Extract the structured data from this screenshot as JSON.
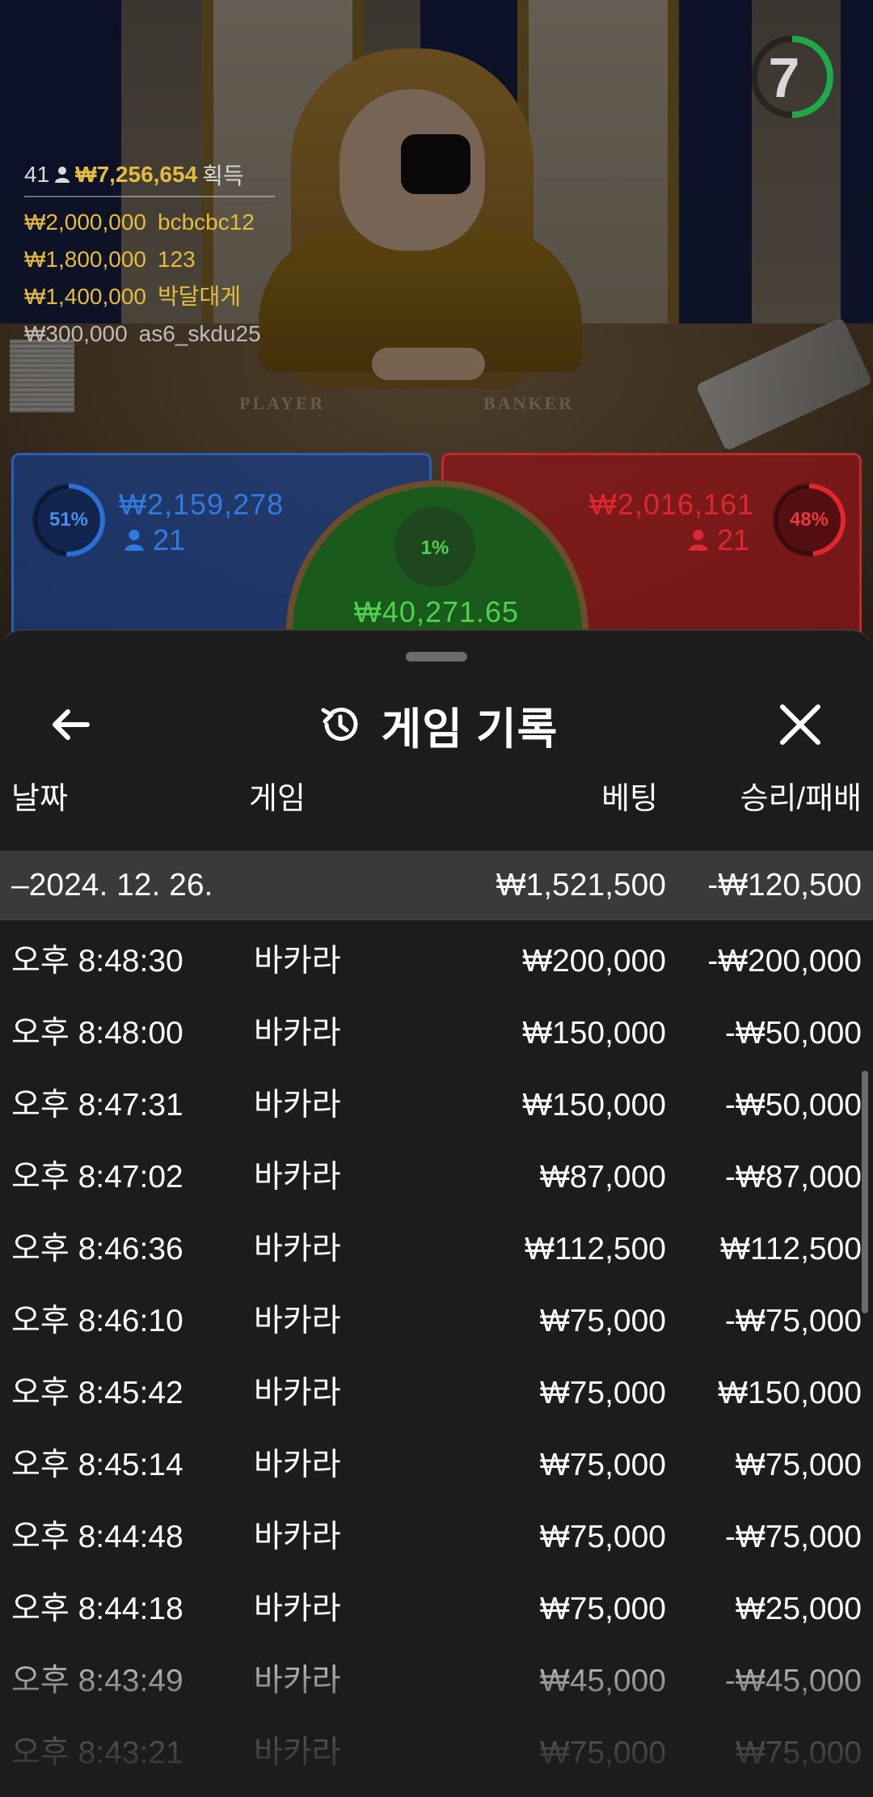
{
  "stream": {
    "timer": "7",
    "table_labels": {
      "player": "PLAYER",
      "banker": "BANKER"
    },
    "winners": {
      "count": "41",
      "total": "₩7,256,654",
      "total_label": "획득",
      "entries": [
        {
          "amount": "₩2,000,000",
          "name": "bcbcbc12"
        },
        {
          "amount": "₩1,800,000",
          "name": "123"
        },
        {
          "amount": "₩1,400,000",
          "name": "박달대게"
        },
        {
          "amount": "₩300,000",
          "name": "as6_skdu25"
        }
      ]
    },
    "player": {
      "percent_label": "51%",
      "percent": 51,
      "amount": "₩2,159,278",
      "count": "21"
    },
    "banker": {
      "percent_label": "48%",
      "percent": 48,
      "amount": "₩2,016,161",
      "count": "21"
    },
    "tie": {
      "percent_label": "1%",
      "amount": "₩40,271.65"
    },
    "colors": {
      "player": "#2a6fd6",
      "banker": "#d8262d",
      "tie": "#3fbf3f",
      "gold": "#e5bc3b"
    }
  },
  "sheet": {
    "title": "게임 기록",
    "icons": {
      "back": "arrow-left-icon",
      "history": "history-icon",
      "close": "close-icon"
    },
    "columns": {
      "date": "날짜",
      "game": "게임",
      "bet": "베팅",
      "result": "승리/패배"
    },
    "day_summary": {
      "date": "–2024. 12. 26.",
      "bet": "₩1,521,500",
      "result": "-₩120,500"
    },
    "rows": [
      {
        "time": "오후 8:48:30",
        "game": "바카라",
        "bet": "₩200,000",
        "result": "-₩200,000"
      },
      {
        "time": "오후 8:48:00",
        "game": "바카라",
        "bet": "₩150,000",
        "result": "-₩50,000"
      },
      {
        "time": "오후 8:47:31",
        "game": "바카라",
        "bet": "₩150,000",
        "result": "-₩50,000"
      },
      {
        "time": "오후 8:47:02",
        "game": "바카라",
        "bet": "₩87,000",
        "result": "-₩87,000"
      },
      {
        "time": "오후 8:46:36",
        "game": "바카라",
        "bet": "₩112,500",
        "result": "₩112,500"
      },
      {
        "time": "오후 8:46:10",
        "game": "바카라",
        "bet": "₩75,000",
        "result": "-₩75,000"
      },
      {
        "time": "오후 8:45:42",
        "game": "바카라",
        "bet": "₩75,000",
        "result": "₩150,000"
      },
      {
        "time": "오후 8:45:14",
        "game": "바카라",
        "bet": "₩75,000",
        "result": "₩75,000"
      },
      {
        "time": "오후 8:44:48",
        "game": "바카라",
        "bet": "₩75,000",
        "result": "-₩75,000"
      },
      {
        "time": "오후 8:44:18",
        "game": "바카라",
        "bet": "₩75,000",
        "result": "₩25,000"
      },
      {
        "time": "오후 8:43:49",
        "game": "바카라",
        "bet": "₩45,000",
        "result": "-₩45,000"
      },
      {
        "time": "오후 8:43:21",
        "game": "바카라",
        "bet": "₩75,000",
        "result": "₩75,000"
      }
    ]
  }
}
